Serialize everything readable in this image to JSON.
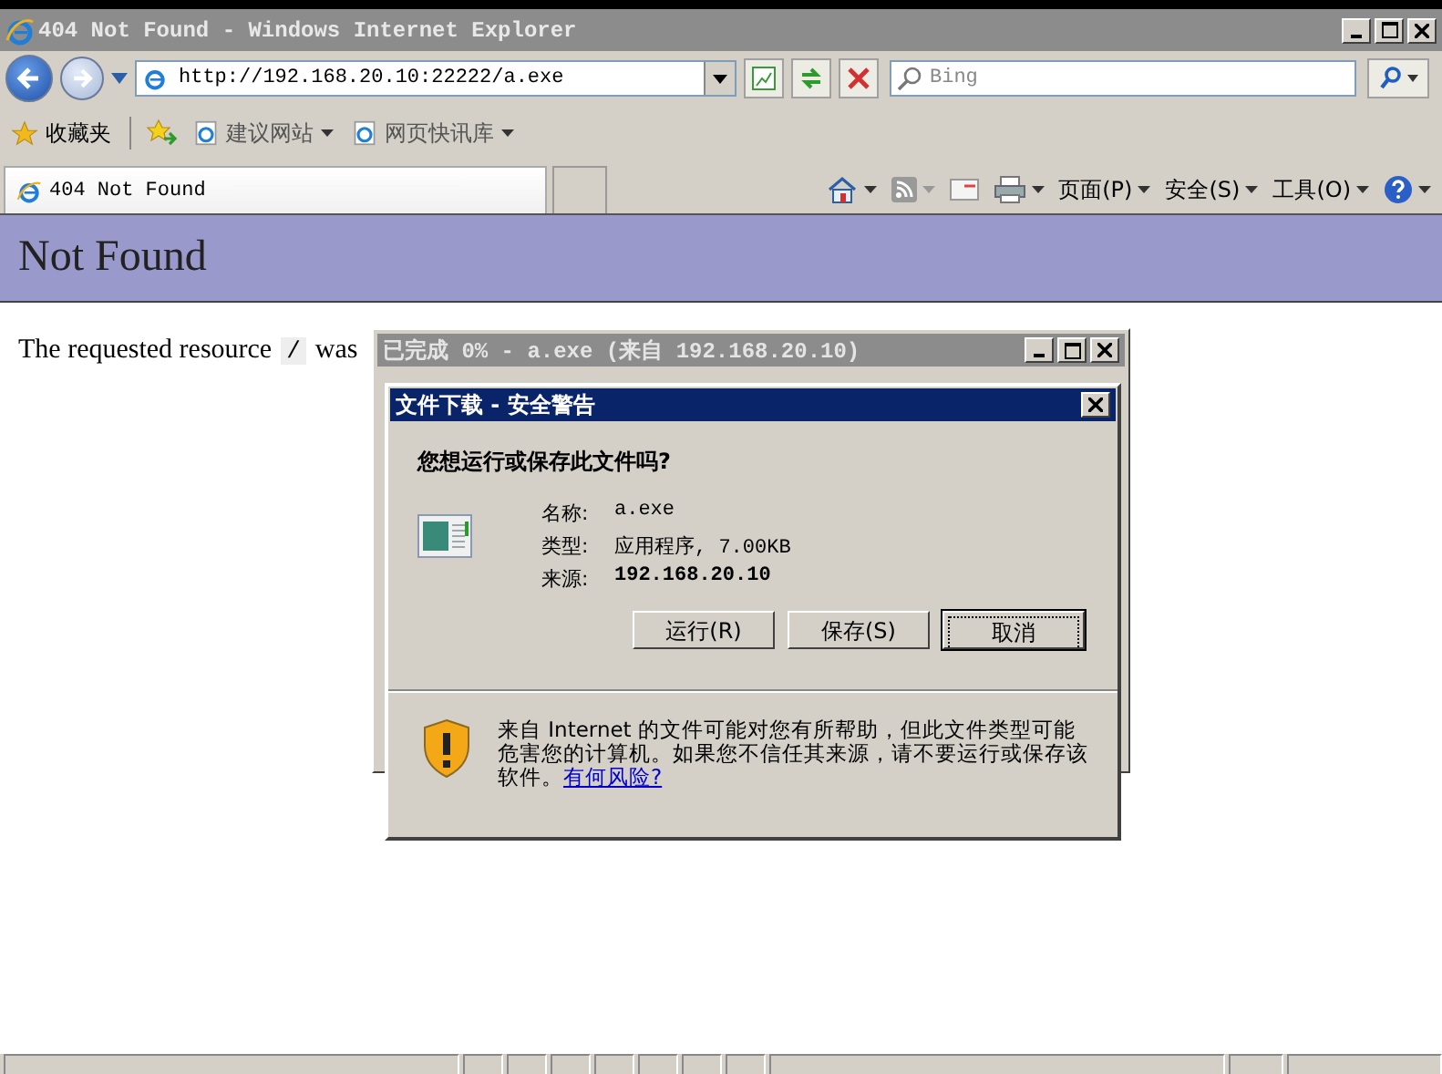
{
  "window": {
    "title": "404 Not Found - Windows Internet Explorer"
  },
  "navigation": {
    "address": "http://192.168.20.10:22222/a.exe",
    "search_placeholder": "Bing"
  },
  "favorites_bar": {
    "label": "收藏夹",
    "items": [
      "建议网站",
      "网页快讯库"
    ]
  },
  "tabs": [
    {
      "label": "404 Not Found",
      "selected": true
    }
  ],
  "command_bar": [
    "页面(P)",
    "安全(S)",
    "工具(O)"
  ],
  "page": {
    "heading": "Not Found",
    "text": "The requested resource",
    "code": "/",
    "text_2": "was"
  },
  "progress_window": {
    "title": "已完成 0% - a.exe (来自 192.168.20.10)"
  },
  "dialog": {
    "title": "文件下载 - 安全警告",
    "question": "您想运行或保存此文件吗?",
    "fields": [
      {
        "label": "名称:",
        "value": "a.exe",
        "bold": false
      },
      {
        "label": "类型:",
        "value": "应用程序, 7.00KB",
        "bold": false
      },
      {
        "label": "来源:",
        "value": "192.168.20.10",
        "bold": true
      }
    ],
    "buttons": [
      {
        "label": "运行(R)",
        "default": false
      },
      {
        "label": "保存(S)",
        "default": false
      },
      {
        "label": "取消",
        "default": true
      }
    ],
    "warning": "来自 Internet 的文件可能对您有所帮助，但此文件类型可能危害您的计算机。如果您不信任其来源，请不要运行或保存该软件。",
    "link": "有何风险?"
  }
}
